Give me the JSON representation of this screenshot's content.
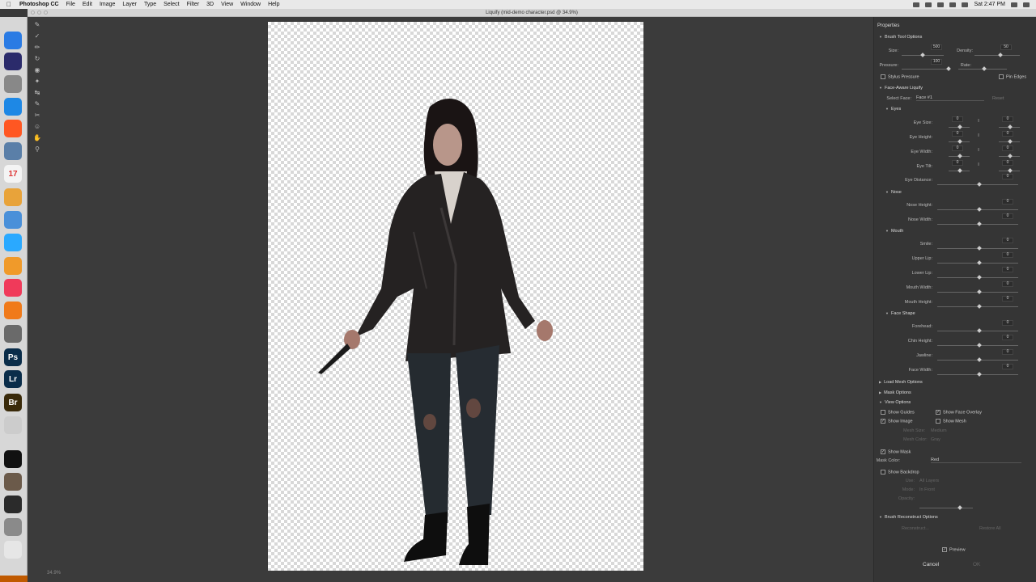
{
  "menubar": {
    "app": "Photoshop CC",
    "items": [
      "File",
      "Edit",
      "Image",
      "Layer",
      "Type",
      "Select",
      "Filter",
      "3D",
      "View",
      "Window",
      "Help"
    ],
    "clock": "Sat 2:47 PM"
  },
  "window": {
    "title": "Liquify (mid-demo character.psd @ 34.9%)"
  },
  "status": {
    "zoom": "34.9%"
  },
  "dock": {
    "apps": [
      {
        "name": "finder",
        "label": "",
        "color": "#2a7be4"
      },
      {
        "name": "siri",
        "label": "",
        "color": "#2b2b6b"
      },
      {
        "name": "launchpad",
        "label": "",
        "color": "#888888"
      },
      {
        "name": "safari",
        "label": "",
        "color": "#1e88e5"
      },
      {
        "name": "brave",
        "label": "",
        "color": "#ff5722"
      },
      {
        "name": "preview",
        "label": "",
        "color": "#5a7fa8"
      },
      {
        "name": "calendar",
        "label": "17",
        "color": "#f4f4f4"
      },
      {
        "name": "photos",
        "label": "",
        "color": "#e8a33a"
      },
      {
        "name": "mail",
        "label": "",
        "color": "#4a90d9"
      },
      {
        "name": "messages",
        "label": "",
        "color": "#2aa9ff"
      },
      {
        "name": "pages",
        "label": "",
        "color": "#f09a2a"
      },
      {
        "name": "music",
        "label": "",
        "color": "#f03a5a"
      },
      {
        "name": "books",
        "label": "",
        "color": "#f07a1a"
      },
      {
        "name": "system-prefs",
        "label": "",
        "color": "#6a6a6a"
      },
      {
        "name": "photoshop",
        "label": "Ps",
        "color": "#0a2d4a"
      },
      {
        "name": "lightroom",
        "label": "Lr",
        "color": "#0a2d4a"
      },
      {
        "name": "bridge",
        "label": "Br",
        "color": "#3a2a0a"
      },
      {
        "name": "zbrush",
        "label": "",
        "color": "#cccccc"
      },
      {
        "name": "terminal",
        "label": "",
        "color": "#111111"
      },
      {
        "name": "thumb-1",
        "label": "",
        "color": "#6b5a4a"
      },
      {
        "name": "thumb-2",
        "label": "",
        "color": "#2b2b2b"
      },
      {
        "name": "downloads",
        "label": "",
        "color": "#8a8a8a"
      },
      {
        "name": "trash",
        "label": "",
        "color": "#e6e6e6"
      }
    ]
  },
  "panel": {
    "title": "Properties",
    "brush": {
      "section": "Brush Tool Options",
      "size_label": "Size:",
      "size": "500",
      "density_label": "Density:",
      "density": "50",
      "pressure_label": "Pressure:",
      "pressure": "100",
      "rate_label": "Rate:",
      "stylus_label": "Stylus Pressure",
      "pin_label": "Pin Edges"
    },
    "face": {
      "section": "Face-Aware Liquify",
      "select_label": "Select Face:",
      "select_value": "Face #1",
      "reset_label": "Reset",
      "eyes_section": "Eyes",
      "eyes": [
        {
          "label": "Eye Size:",
          "l": "0",
          "r": "0"
        },
        {
          "label": "Eye Height:",
          "l": "0",
          "r": "0"
        },
        {
          "label": "Eye Width:",
          "l": "0",
          "r": "0"
        },
        {
          "label": "Eye Tilt:",
          "l": "0",
          "r": "0"
        }
      ],
      "eye_distance_label": "Eye Distance:",
      "eye_distance": "0",
      "nose_section": "Nose",
      "nose": [
        {
          "label": "Nose Height:",
          "v": "0"
        },
        {
          "label": "Nose Width:",
          "v": "0"
        }
      ],
      "mouth_section": "Mouth",
      "mouth": [
        {
          "label": "Smile:",
          "v": "0"
        },
        {
          "label": "Upper Lip:",
          "v": "0"
        },
        {
          "label": "Lower Lip:",
          "v": "0"
        },
        {
          "label": "Mouth Width:",
          "v": "0"
        },
        {
          "label": "Mouth Height:",
          "v": "0"
        }
      ],
      "shape_section": "Face Shape",
      "shape": [
        {
          "label": "Forehead:",
          "v": "0"
        },
        {
          "label": "Chin Height:",
          "v": "0"
        },
        {
          "label": "Jawline:",
          "v": "0"
        },
        {
          "label": "Face Width:",
          "v": "0"
        }
      ]
    },
    "load_mesh": "Load Mesh Options",
    "mask": "Mask Options",
    "view": {
      "section": "View Options",
      "show_guides": "Show Guides",
      "show_face_overlay": "Show Face Overlay",
      "show_image": "Show Image",
      "show_mesh_small": "Show Mesh",
      "mesh_size_label": "Mesh Size:",
      "mesh_size": "Medium",
      "mesh_color_label": "Mesh Color:",
      "mesh_color": "Gray",
      "show_mask": "Show Mask",
      "mask_color_label": "Mask Color:",
      "mask_color": "Red",
      "show_backdrop": "Show Backdrop",
      "use_label": "Use:",
      "use": "All Layers",
      "mode_label": "Mode:",
      "mode": "In Front",
      "opacity_label": "Opacity:"
    },
    "reconstruct": "Brush Reconstruct Options",
    "reconstruct_btn": "Reconstruct...",
    "restore_btn": "Restore All",
    "preview": "Preview",
    "cancel": "Cancel",
    "ok": "OK"
  }
}
